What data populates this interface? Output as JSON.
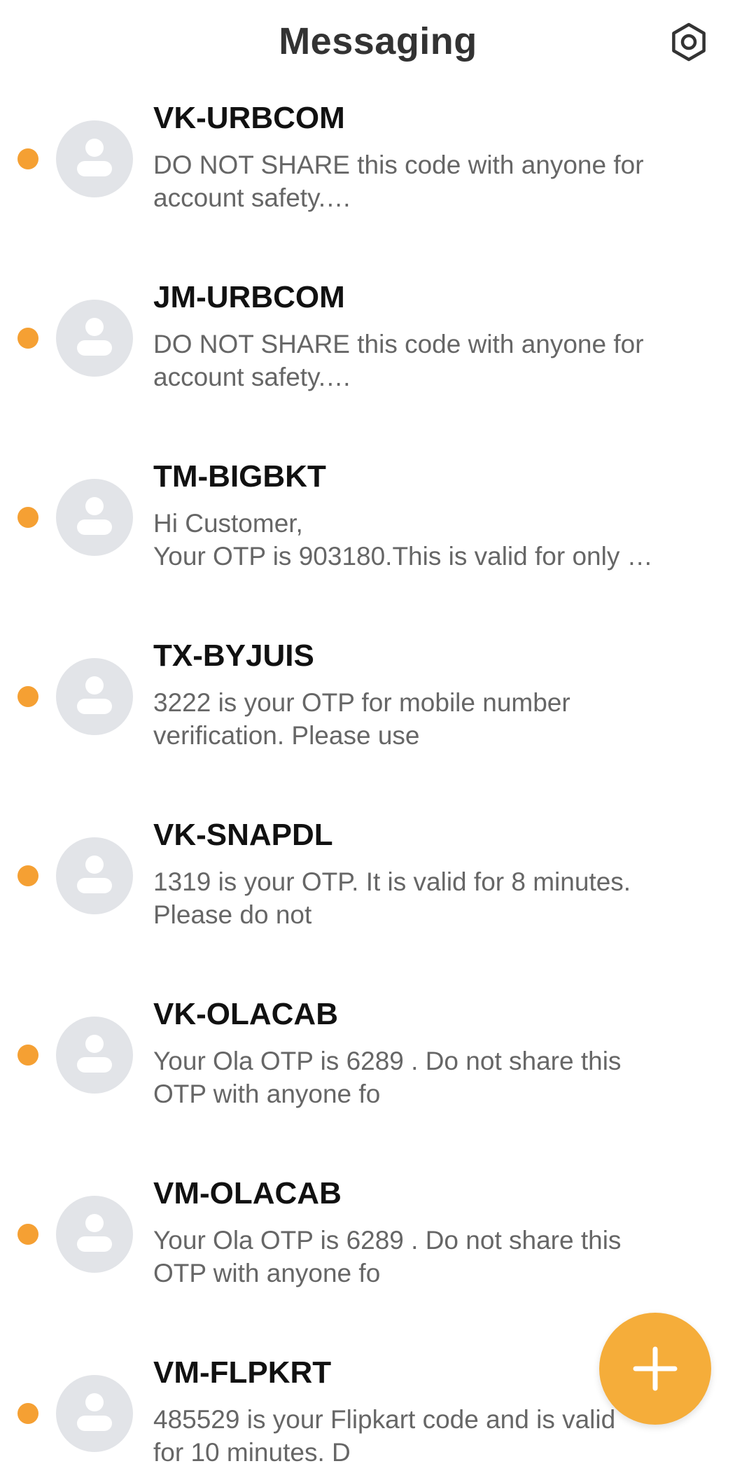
{
  "header": {
    "title": "Messaging",
    "settings_icon": "settings-hex-icon"
  },
  "colors": {
    "accent": "#f5a033",
    "avatar_bg": "#e2e4e8",
    "title_text": "#333333",
    "snippet_text": "#666666"
  },
  "conversations": [
    {
      "sender": "VK-URBCOM",
      "snippet": "DO NOT SHARE this code with anyone for\naccount safety.…",
      "unread": true
    },
    {
      "sender": "JM-URBCOM",
      "snippet": "DO NOT SHARE this code with anyone for\naccount safety.…",
      "unread": true
    },
    {
      "sender": "TM-BIGBKT",
      "snippet": "Hi Customer,\nYour OTP is 903180.This is valid for only …",
      "unread": true
    },
    {
      "sender": "TX-BYJUIS",
      "snippet": "3222 is your OTP for mobile number\nverification. Please use",
      "unread": true
    },
    {
      "sender": "VK-SNAPDL",
      "snippet": "1319 is your OTP. It is valid for 8 minutes.\nPlease do not",
      "unread": true
    },
    {
      "sender": "VK-OLACAB",
      "snippet": "Your Ola OTP is 6289 . Do not share this\nOTP with anyone fo",
      "unread": true
    },
    {
      "sender": "VM-OLACAB",
      "snippet": "Your Ola OTP is 6289 . Do not share this\nOTP with anyone fo",
      "unread": true
    },
    {
      "sender": "VM-FLPKRT",
      "snippet": "485529 is your Flipkart code and is valid\nfor 10 minutes. D",
      "unread": true
    }
  ],
  "fab": {
    "icon": "plus-icon",
    "action": "new-message"
  }
}
